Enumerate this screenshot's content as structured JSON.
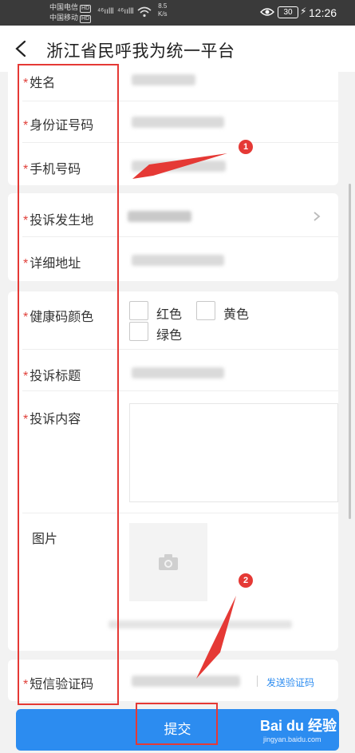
{
  "status_bar": {
    "carrier1": "中国电信",
    "carrier2": "中国移动",
    "hd": "HD",
    "signal1": "⁴⁶ıılll",
    "signal2": "⁴⁶ıılll",
    "speed_value": "8.5",
    "speed_unit": "K/s",
    "battery": "30",
    "time": "12:26"
  },
  "header": {
    "title": "浙江省民呼我为统一平台",
    "back_icon": "chevron-left-icon"
  },
  "form": {
    "required_mark": "*",
    "name_label": "姓名",
    "id_label": "身份证号码",
    "phone_label": "手机号码",
    "place_label": "投诉发生地",
    "address_label": "详细地址",
    "health_label": "健康码颜色",
    "health_options": [
      "红色",
      "黄色",
      "绿色"
    ],
    "subject_label": "投诉标题",
    "content_label": "投诉内容",
    "image_label": "图片",
    "sms_label": "短信验证码",
    "send_code": "发送验证码"
  },
  "submit_label": "提交",
  "annotations": {
    "badge1": "1",
    "badge2": "2",
    "accent": "#e53935"
  },
  "watermark": {
    "brand": "Bai du 经验",
    "url": "jingyan.baidu.com"
  },
  "colors": {
    "primary": "#2c8cf0",
    "required": "#e0403a"
  }
}
